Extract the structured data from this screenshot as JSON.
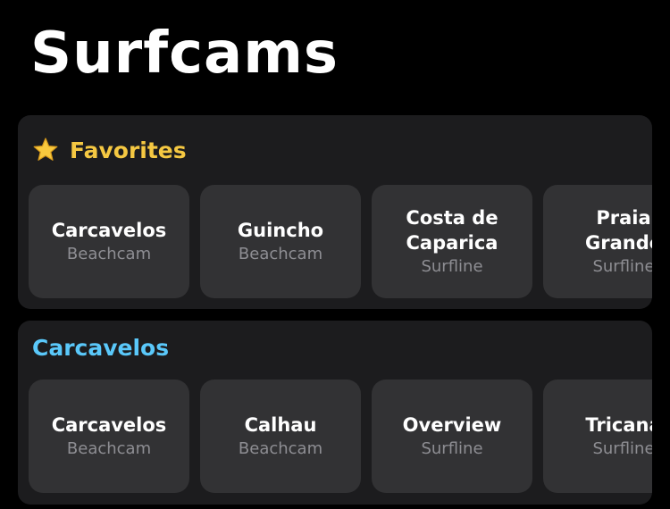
{
  "app": {
    "title": "Surfcams"
  },
  "colors": {
    "background": "#000000",
    "section_background": "#1c1c1e",
    "tile_background": "#323234",
    "favorites_accent": "#f5c842",
    "group_accent": "#5ac8fa",
    "secondary_text": "#8e8e93"
  },
  "favorites": {
    "title": "Favorites",
    "icon": "star-icon",
    "items": [
      {
        "name": "Carcavelos",
        "source": "Beachcam"
      },
      {
        "name": "Guincho",
        "source": "Beachcam"
      },
      {
        "name": "Costa de\nCaparica",
        "source": "Surfline"
      },
      {
        "name": "Praia\nGrande",
        "source": "Surfline"
      }
    ]
  },
  "groups": [
    {
      "title": "Carcavelos",
      "items": [
        {
          "name": "Carcavelos",
          "source": "Beachcam"
        },
        {
          "name": "Calhau",
          "source": "Beachcam"
        },
        {
          "name": "Overview",
          "source": "Surfline"
        },
        {
          "name": "Tricana",
          "source": "Surfline"
        }
      ]
    }
  ]
}
